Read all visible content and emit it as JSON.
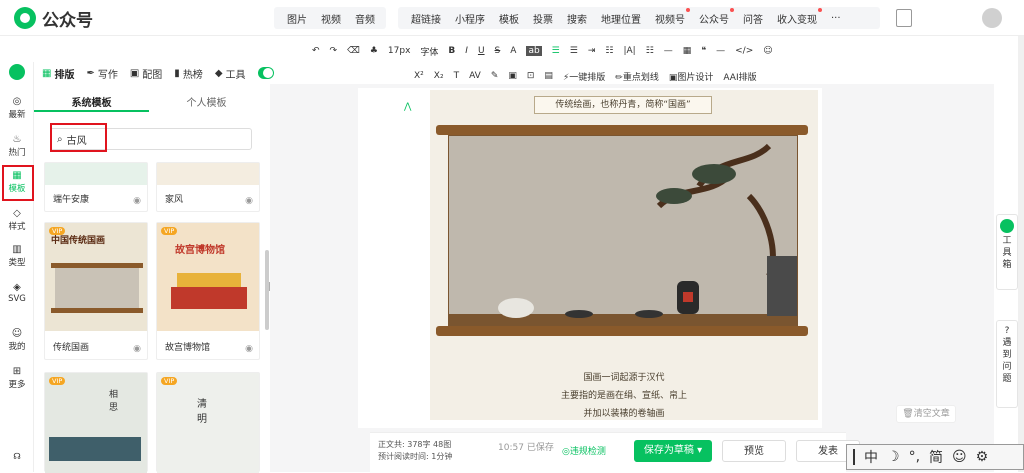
{
  "app": {
    "name": "公众号"
  },
  "nav": {
    "group1": [
      "图片",
      "视频",
      "音频"
    ],
    "group2": [
      {
        "label": "超链接",
        "dot": false
      },
      {
        "label": "小程序",
        "dot": false
      },
      {
        "label": "模板",
        "dot": false
      },
      {
        "label": "投票",
        "dot": false
      },
      {
        "label": "搜索",
        "dot": false
      },
      {
        "label": "地理位置",
        "dot": false
      },
      {
        "label": "视频号",
        "dot": true
      },
      {
        "label": "公众号",
        "dot": true
      },
      {
        "label": "问答",
        "dot": false
      },
      {
        "label": "收入变现",
        "dot": true
      },
      {
        "label": "···",
        "dot": false
      }
    ]
  },
  "toolbar": {
    "font_size": "17px",
    "font_family": "字体",
    "row1_extra": [
      "B",
      "I",
      "U",
      "S",
      "A",
      "ab"
    ],
    "row2": [
      "X²",
      "X₂",
      "T",
      "AV",
      "",
      "一键排版",
      "重点划线",
      "图片设计",
      "AI排版"
    ]
  },
  "rail": [
    {
      "icon": "◎",
      "label": "最新"
    },
    {
      "icon": "♨",
      "label": "热门"
    },
    {
      "icon": "▦",
      "label": "模板"
    },
    {
      "icon": "◇",
      "label": "样式"
    },
    {
      "icon": "▥",
      "label": "类型"
    },
    {
      "icon": "◈",
      "label": "SVG"
    },
    {
      "icon": "☺",
      "label": "我的"
    },
    {
      "icon": "⊞",
      "label": "更多"
    }
  ],
  "tabs": {
    "items": [
      "排版",
      "写作",
      "配图",
      "热榜",
      "工具"
    ]
  },
  "panel": {
    "tab_system": "系统模板",
    "tab_personal": "个人模板",
    "search_value": "古风",
    "cards": [
      {
        "label": "端午安康",
        "vip": false
      },
      {
        "label": "家风",
        "vip": false
      },
      {
        "label": "传统国画",
        "vip": true,
        "thumb_title": "中国传统国画"
      },
      {
        "label": "故宫博物馆",
        "vip": true,
        "thumb_title": "故宫博物馆"
      },
      {
        "label": "",
        "vip": true,
        "thumb_title": "相思"
      },
      {
        "label": "",
        "vip": true,
        "thumb_title": "清明"
      }
    ]
  },
  "article": {
    "caption": "传统绘画，也称丹青，简称“国画”",
    "lines": [
      "国画一词起源于汉代",
      "主要指的是画在绢、宣纸、帛上",
      "并加以装裱的卷轴画"
    ]
  },
  "side_tools": {
    "toolbox": "工具箱",
    "faq": "遇到问题"
  },
  "footer": {
    "word_count_label": "正文共:",
    "word_count": "378字 48图",
    "read_time_label": "预计阅读时间:",
    "read_time": "1分钟",
    "saved_time": "10:57",
    "saved_label": "已保存",
    "check": "违规检测",
    "save": "保存为草稿",
    "preview": "预览",
    "publish": "发表",
    "clear": "清空文章"
  },
  "ime": [
    "中",
    "☽",
    "°,",
    "简",
    "☺",
    "⚙"
  ],
  "colors": {
    "brand": "#07c160",
    "highlight": "#e0141e",
    "scroll_wood": "#8a5a2b"
  }
}
